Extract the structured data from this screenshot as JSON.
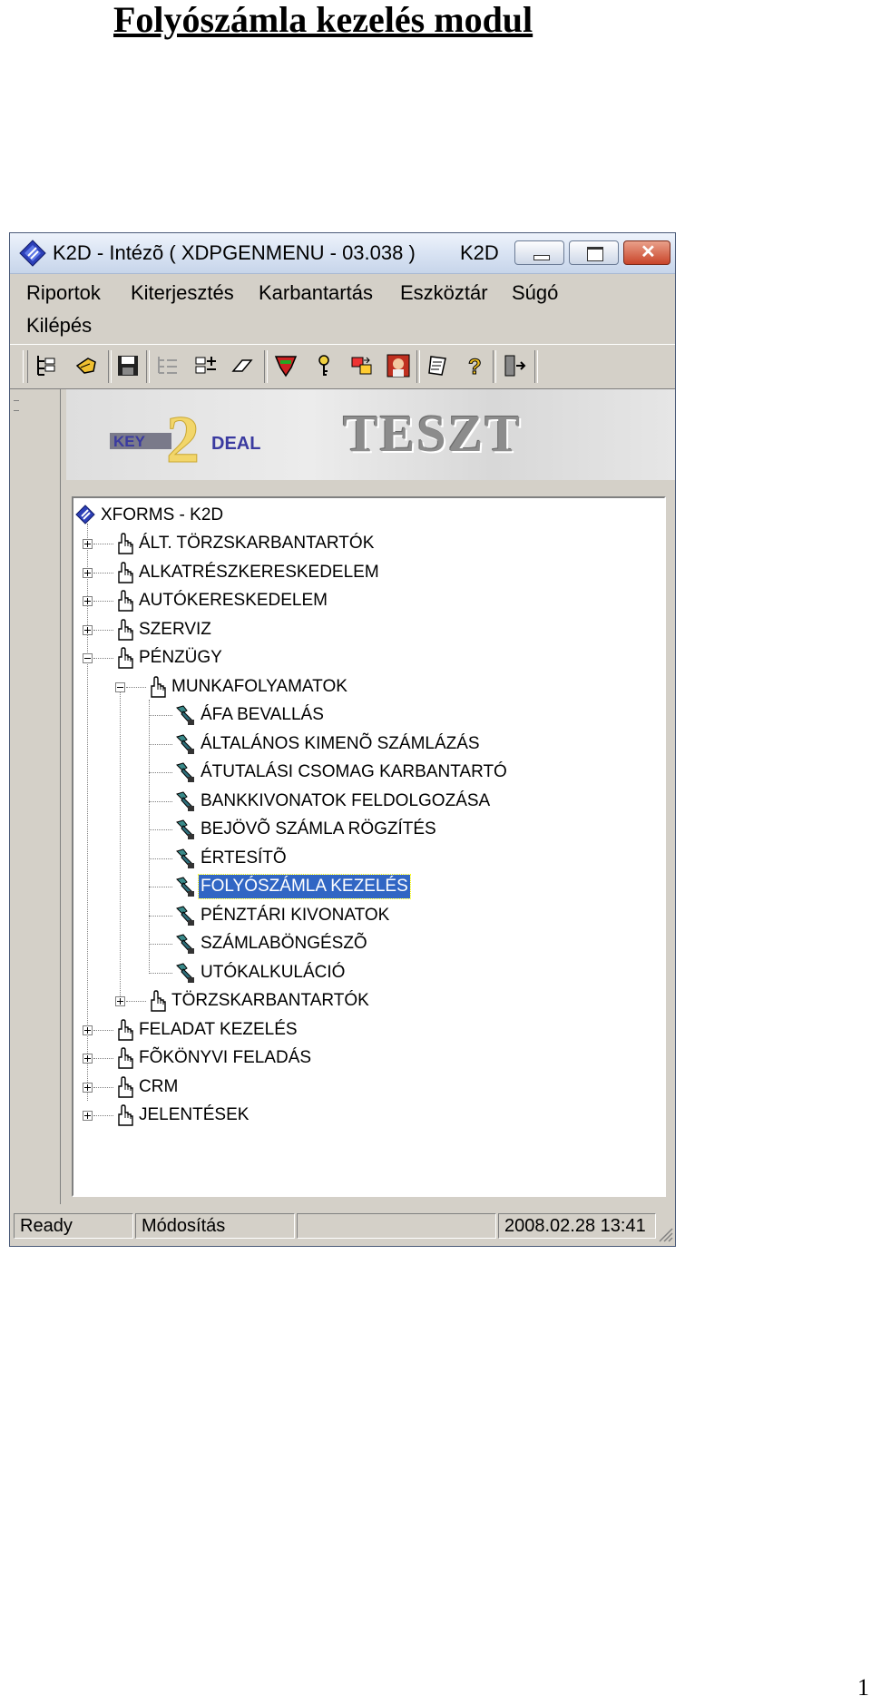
{
  "document": {
    "title": "Folyószámla kezelés modul",
    "page_number": "1"
  },
  "window": {
    "title": "K2D - Intézõ ( XDPGENMENU - 03.038 )",
    "title_right": "K2D"
  },
  "menu": {
    "items": [
      "Riportok",
      "Kiterjesztés",
      "Karbantartás",
      "Eszköztár",
      "Súgó",
      "Kilépés"
    ]
  },
  "banner": {
    "logo_left": "KEY",
    "logo_num": "2",
    "logo_right": "DEAL",
    "env_label": "TESZT"
  },
  "tree": {
    "root": "XFORMS - K2D",
    "items": [
      {
        "label": "ÁLT. TÖRZSKARBANTARTÓK",
        "level": 1,
        "type": "folder",
        "state": "collapsed"
      },
      {
        "label": "ALKATRÉSZKERESKEDELEM",
        "level": 1,
        "type": "folder",
        "state": "collapsed"
      },
      {
        "label": "AUTÓKERESKEDELEM",
        "level": 1,
        "type": "folder",
        "state": "collapsed"
      },
      {
        "label": "SZERVIZ",
        "level": 1,
        "type": "folder",
        "state": "collapsed"
      },
      {
        "label": "PÉNZÜGY",
        "level": 1,
        "type": "folder",
        "state": "expanded"
      },
      {
        "label": "MUNKAFOLYAMATOK",
        "level": 2,
        "type": "folder",
        "state": "expanded"
      },
      {
        "label": "ÁFA BEVALLÁS",
        "level": 3,
        "type": "leaf"
      },
      {
        "label": "ÁLTALÁNOS KIMENÕ SZÁMLÁZÁS",
        "level": 3,
        "type": "leaf"
      },
      {
        "label": "ÁTUTALÁSI CSOMAG KARBANTARTÓ",
        "level": 3,
        "type": "leaf"
      },
      {
        "label": "BANKKIVONATOK FELDOLGOZÁSA",
        "level": 3,
        "type": "leaf"
      },
      {
        "label": "BEJÖVÕ SZÁMLA RÖGZÍTÉS",
        "level": 3,
        "type": "leaf"
      },
      {
        "label": "ÉRTESÍTÕ",
        "level": 3,
        "type": "leaf"
      },
      {
        "label": "FOLYÓSZÁMLA KEZELÉS",
        "level": 3,
        "type": "leaf",
        "selected": true
      },
      {
        "label": "PÉNZTÁRI KIVONATOK",
        "level": 3,
        "type": "leaf"
      },
      {
        "label": "SZÁMLABÖNGÉSZÕ",
        "level": 3,
        "type": "leaf"
      },
      {
        "label": "UTÓKALKULÁCIÓ",
        "level": 3,
        "type": "leaf"
      },
      {
        "label": "TÖRZSKARBANTARTÓK",
        "level": 2,
        "type": "folder",
        "state": "collapsed"
      },
      {
        "label": "FELADAT KEZELÉS",
        "level": 1,
        "type": "folder",
        "state": "collapsed"
      },
      {
        "label": "FÕKÖNYVI FELADÁS",
        "level": 1,
        "type": "folder",
        "state": "collapsed"
      },
      {
        "label": "CRM",
        "level": 1,
        "type": "folder",
        "state": "collapsed"
      },
      {
        "label": "JELENTÉSEK",
        "level": 1,
        "type": "folder",
        "state": "collapsed"
      }
    ]
  },
  "status": {
    "state": "Ready",
    "mode": "Módosítás",
    "datetime": "2008.02.28 13:41"
  },
  "colors": {
    "selection": "#3166c4",
    "window_face": "#d4d0c8",
    "title_gradient": "#dbe5f4"
  }
}
